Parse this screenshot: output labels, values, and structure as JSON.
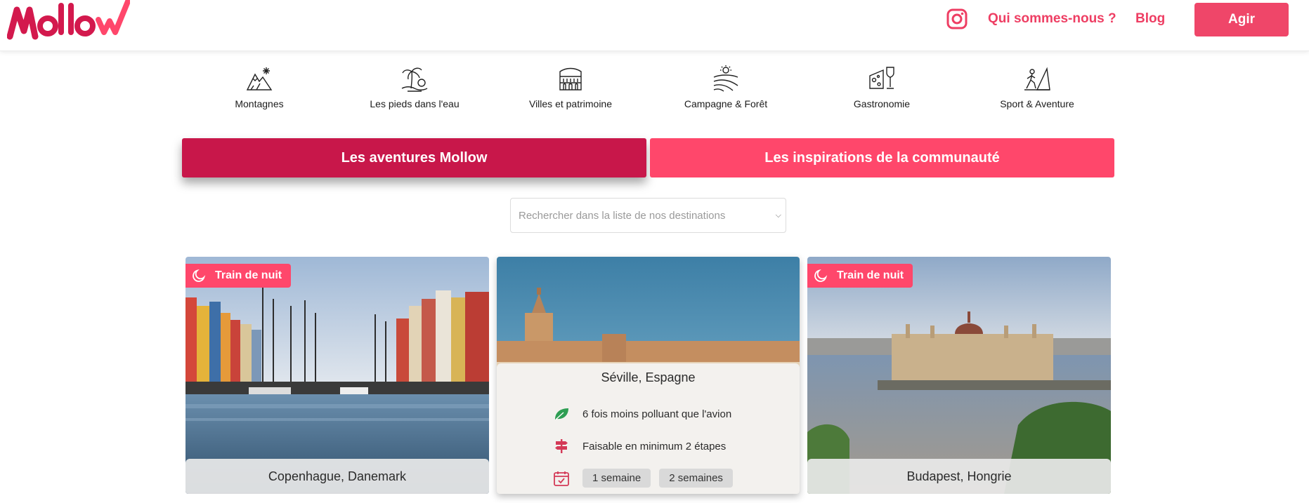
{
  "header": {
    "logo_text": "Mollow",
    "nav": {
      "about": "Qui sommes-nous ?",
      "blog": "Blog"
    },
    "cta": "Agir"
  },
  "categories": [
    {
      "label": "Montagnes",
      "icon": "mountain-icon"
    },
    {
      "label": "Les pieds dans l'eau",
      "icon": "palm-beach-icon"
    },
    {
      "label": "Villes et patrimoine",
      "icon": "colosseum-icon"
    },
    {
      "label": "Campagne & Forêt",
      "icon": "countryside-icon"
    },
    {
      "label": "Gastronomie",
      "icon": "cheese-wine-icon"
    },
    {
      "label": "Sport & Aventure",
      "icon": "hiker-icon"
    }
  ],
  "tabs": {
    "active": "Les aventures Mollow",
    "inactive": "Les inspirations de la communauté"
  },
  "search": {
    "placeholder": "Rechercher dans la liste de nos destinations"
  },
  "cards": [
    {
      "title": "Copenhague, Danemark",
      "badge": "Train de nuit"
    },
    {
      "title": "Séville, Espagne",
      "eco": "6 fois moins polluant que l'avion",
      "steps": "Faisable en minimum 2 étapes",
      "durations": [
        "1 semaine",
        "2 semaines"
      ]
    },
    {
      "title": "Budapest, Hongrie",
      "badge": "Train de nuit"
    }
  ],
  "colors": {
    "brand_pink": "#ff476b",
    "brand_dark": "#c8174a",
    "link_pink": "#ee3e63"
  }
}
